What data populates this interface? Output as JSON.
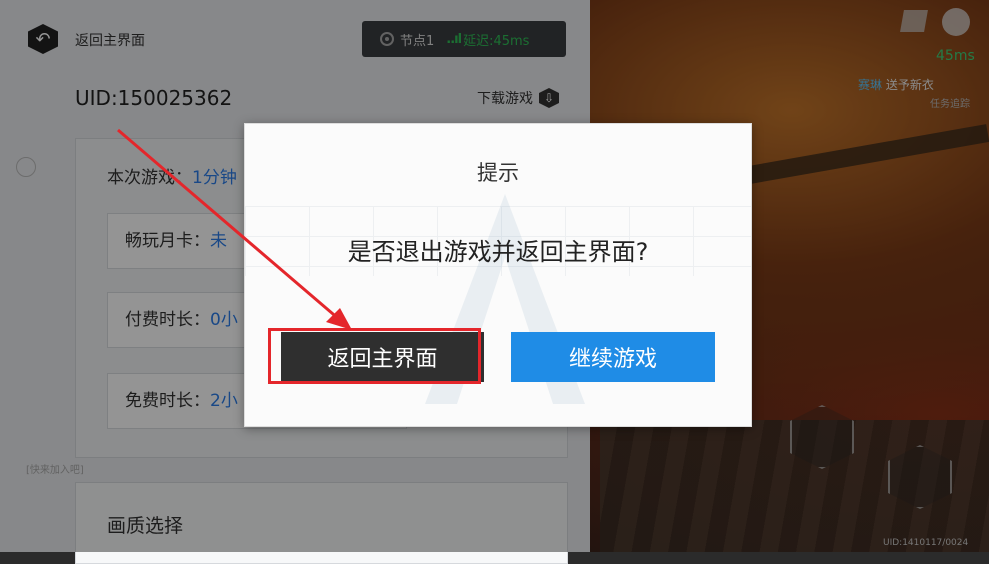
{
  "sidebar": {
    "back_label": "返回主界面",
    "node_label": "节点1",
    "signal_glyph": "..ıl",
    "latency_label": "延迟:45ms",
    "uid": "UID:150025362",
    "download_label": "下载游戏",
    "play_time_label": "本次游戏：",
    "play_time_value": "1分钟",
    "rows": [
      {
        "label": "畅玩月卡：",
        "value": "未"
      },
      {
        "label": "付费时长：",
        "value": "0小"
      },
      {
        "label": "免费时长：",
        "value": "2小"
      }
    ],
    "quality_label": "画质选择"
  },
  "hud": {
    "latency": "45ms",
    "quest_name": "赛琳",
    "quest_text": "送予新衣",
    "quest_sub": "任务追踪",
    "uid": "UID:1410117/0024",
    "chat": "[快来加入吧]"
  },
  "dialog": {
    "title": "提示",
    "message": "是否退出游戏并返回主界面?",
    "back_button": "返回主界面",
    "continue_button": "继续游戏"
  },
  "colors": {
    "accent_blue": "#1f8ce6",
    "latency_green": "#2fbf57",
    "highlight_red": "#e4262b",
    "link_blue": "#2b7de9"
  }
}
